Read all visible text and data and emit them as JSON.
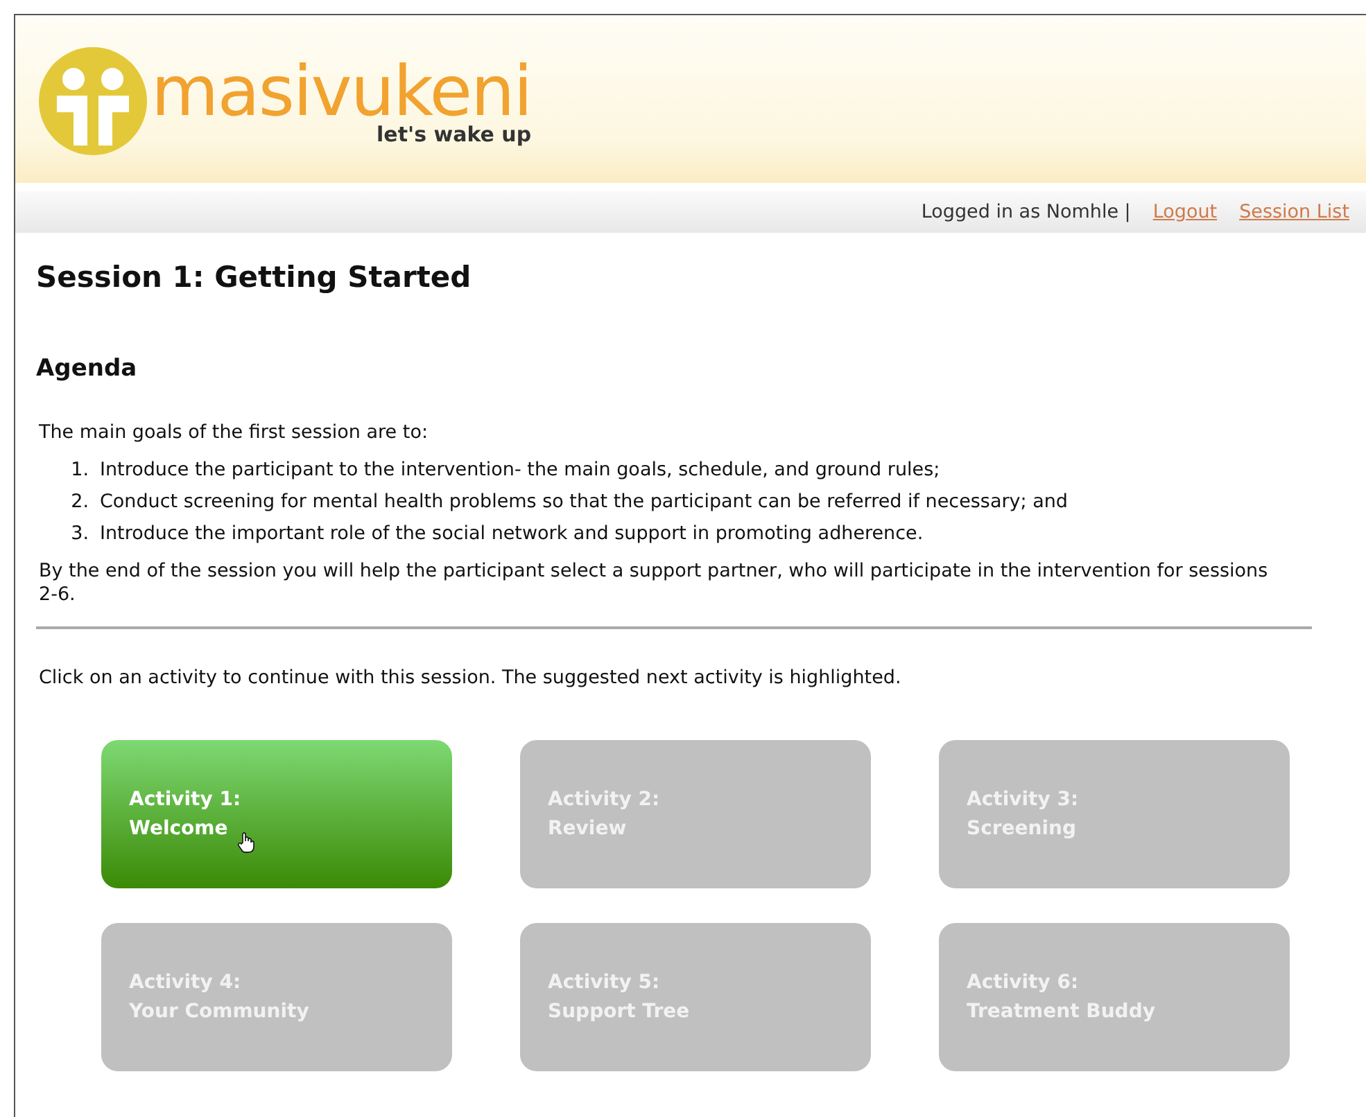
{
  "header": {
    "logo_text": "masivukeni",
    "tagline": "let's wake up"
  },
  "user_bar": {
    "logged_in": "Logged in as Nomhle |",
    "links": [
      "Logout",
      "Session List"
    ]
  },
  "title": "Session 1: Getting Started",
  "agenda": {
    "heading": "Agenda",
    "intro": "The main goals of the first session are to:",
    "goals": [
      {
        "number": "1.",
        "text": "Introduce the participant to the intervention- the main goals, schedule, and ground rules;"
      },
      {
        "number": "2.",
        "text": "Conduct screening for mental health problems so that the participant can be referred if necessary; and"
      },
      {
        "number": "3.",
        "text": "Introduce the important role of the social network and support in promoting adherence."
      }
    ],
    "outro": "By the end of the session you will help the participant select a support partner, who will participate in the intervention for sessions 2-6."
  },
  "instruction": "Click on an activity to continue with this session. The suggested next activity is highlighted.",
  "activities": [
    {
      "label": "Activity 1:",
      "name": "Welcome",
      "selected": true
    },
    {
      "label": "Activity 2:",
      "name": "Review",
      "selected": false
    },
    {
      "label": "Activity 3:",
      "name": "Screening",
      "selected": false
    },
    {
      "label": "Activity 4:",
      "name": "Your Community",
      "selected": false
    },
    {
      "label": "Activity 5:",
      "name": "Support Tree",
      "selected": false
    },
    {
      "label": "Activity 6:",
      "name": "Treatment Buddy",
      "selected": false
    }
  ]
}
